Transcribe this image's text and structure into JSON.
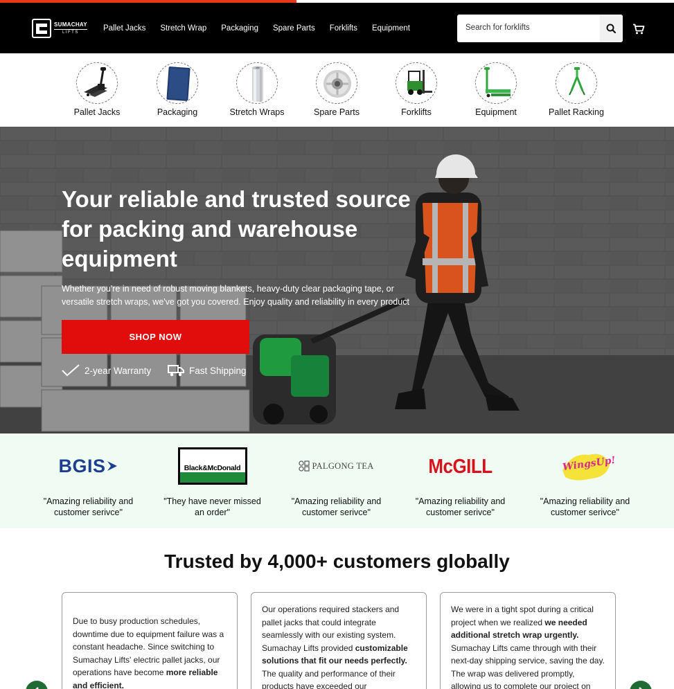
{
  "page_progress": 0.44,
  "colors": {
    "accent": "#e10d0d",
    "header_bg": "#000000",
    "logo_band_bg": "#effbf3",
    "carousel_arrow": "#1f6b33"
  },
  "header": {
    "logo_line1": "SUMACHAY",
    "logo_line2": "LIFTS",
    "nav": [
      "Pallet Jacks",
      "Stretch Wrap",
      "Packaging",
      "Spare Parts",
      "Forklifts",
      "Equipment"
    ],
    "search_placeholder": "Search for forklifts",
    "search_icon": "search-icon",
    "cart_icon": "cart-icon"
  },
  "categories": [
    {
      "label": "Pallet Jacks",
      "icon": "pallet-jack-image"
    },
    {
      "label": "Packaging",
      "icon": "packaging-image"
    },
    {
      "label": "Stretch Wraps",
      "icon": "stretch-wrap-image"
    },
    {
      "label": "Spare Parts",
      "icon": "spare-part-wheel-image"
    },
    {
      "label": "Forklifts",
      "icon": "forklift-image"
    },
    {
      "label": "Equipment",
      "icon": "equipment-image"
    },
    {
      "label": "Pallet Racking",
      "icon": "pallet-racking-image"
    }
  ],
  "hero": {
    "title_lines": [
      "Your reliable and trusted source",
      "for packing and warehouse",
      "equipment"
    ],
    "subtitle_lines": [
      "Whether you're in need of robust moving blankets, heavy-duty clear packaging tape, or",
      "versatile stretch wraps, we've got you covered. Enjoy quality and reliability in every product"
    ],
    "cta": "SHOP NOW",
    "perks": [
      {
        "label": "2-year Warranty",
        "icon": "checkmark-icon"
      },
      {
        "label": "Fast Shipping",
        "icon": "truck-icon"
      }
    ]
  },
  "brands": [
    {
      "logo_text": "BGIS",
      "quote_lines": [
        "\"Amazing reliability and",
        "customer serivce\""
      ]
    },
    {
      "logo_text": "Black&McDonald",
      "quote_lines": [
        "\"They have never missed",
        "an order\""
      ]
    },
    {
      "logo_text": "PALGONG TEA",
      "quote_lines": [
        "\"Amazing reliability and",
        "customer serivce\""
      ]
    },
    {
      "logo_text": "McGILL",
      "quote_lines": [
        "\"Amazing reliability and",
        "customer serivce\""
      ]
    },
    {
      "logo_text": "WingsUp!",
      "quote_lines": [
        "\"Amazing reliability and",
        "customer serivce\""
      ]
    }
  ],
  "testimonials": {
    "heading": "Trusted by 4,000+ customers globally",
    "cards": [
      {
        "segments": [
          {
            "text": "Due to busy production schedules, downtime due to equipment failure was a constant headache. Since switching to Sumachay Lifts' electric pallet jacks, our operations have become ",
            "bold": false
          },
          {
            "text": "more reliable and efficient.",
            "bold": true
          }
        ]
      },
      {
        "segments": [
          {
            "text": "Our operations required stackers and pallet jacks that could integrate seamlessly with our existing system. Sumachay Lifts provided ",
            "bold": false
          },
          {
            "text": "customizable solutions that fit our needs perfectly.",
            "bold": true
          },
          {
            "text": " The quality and performance of their products have exceeded our",
            "bold": false
          }
        ]
      },
      {
        "segments": [
          {
            "text": "We were in a tight spot during a critical project when we realized ",
            "bold": false
          },
          {
            "text": "we needed additional stretch wrap urgently.",
            "bold": true
          },
          {
            "text": " Sumachay Lifts came through with their next-day shipping service, saving the day. The wrap was delivered promptly, allowing us to complete our project on",
            "bold": false
          }
        ]
      }
    ],
    "prev_icon": "chevron-left-icon",
    "next_icon": "chevron-right-icon"
  }
}
